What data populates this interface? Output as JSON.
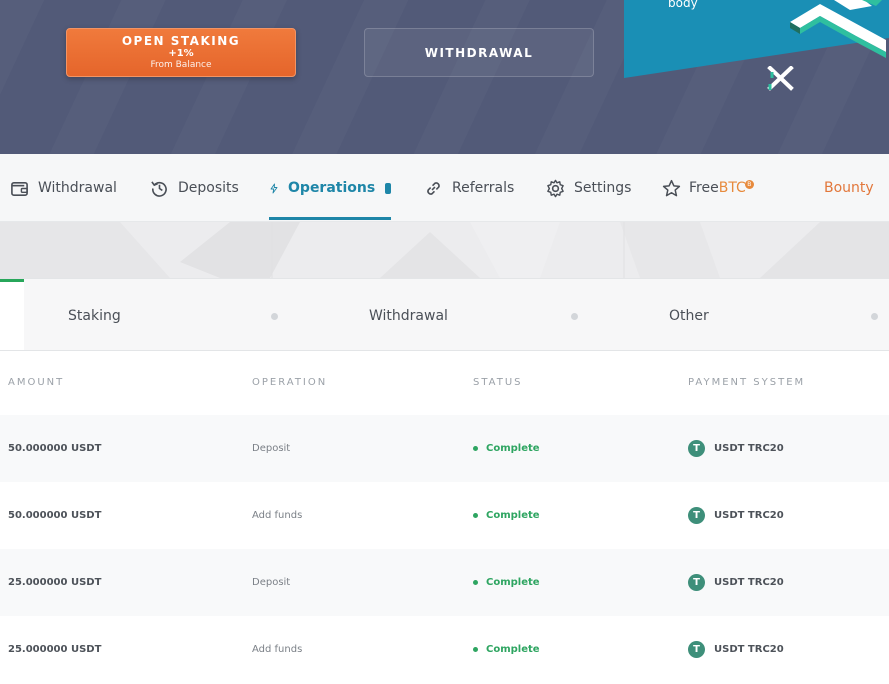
{
  "hero": {
    "staking_button": {
      "title": "OPEN STAKING",
      "bonus": "+1%",
      "subtitle": "From Balance"
    },
    "withdrawal_button": {
      "label": "WITHDRAWAL"
    },
    "promo": {
      "text": "body",
      "colors": {
        "panel": "#1a8fb5",
        "logo": "#2fbf9f"
      }
    }
  },
  "nav": {
    "items": [
      {
        "label": "Withdrawal",
        "icon": "wallet-icon"
      },
      {
        "label": "Deposits",
        "icon": "history-icon"
      },
      {
        "label": "Operations",
        "icon": "bolt-icon",
        "active": true
      },
      {
        "label": "Referrals",
        "icon": "link-icon"
      },
      {
        "label": "Settings",
        "icon": "gear-icon"
      },
      {
        "label_main": "Free",
        "label_accent": "BTC",
        "badge": "B",
        "icon": "star-icon"
      },
      {
        "label": "Bounty"
      }
    ],
    "colors": {
      "active": "#1e86a8",
      "accent": "#e2773b"
    }
  },
  "subtabs": {
    "items": [
      "Staking",
      "Withdrawal",
      "Other"
    ],
    "active_color": "#27a65a"
  },
  "table": {
    "headers": [
      "AMOUNT",
      "OPERATION",
      "STATUS",
      "PAYMENT SYSTEM"
    ],
    "rows": [
      {
        "amount": "50.000000 USDT",
        "operation": "Deposit",
        "status": "Complete",
        "payment": "USDT TRC20"
      },
      {
        "amount": "50.000000 USDT",
        "operation": "Add funds",
        "status": "Complete",
        "payment": "USDT TRC20"
      },
      {
        "amount": "25.000000 USDT",
        "operation": "Deposit",
        "status": "Complete",
        "payment": "USDT TRC20"
      },
      {
        "amount": "25.000000 USDT",
        "operation": "Add funds",
        "status": "Complete",
        "payment": "USDT TRC20"
      }
    ],
    "payment_icon_glyph": "T",
    "status_color": "#2ea561"
  }
}
